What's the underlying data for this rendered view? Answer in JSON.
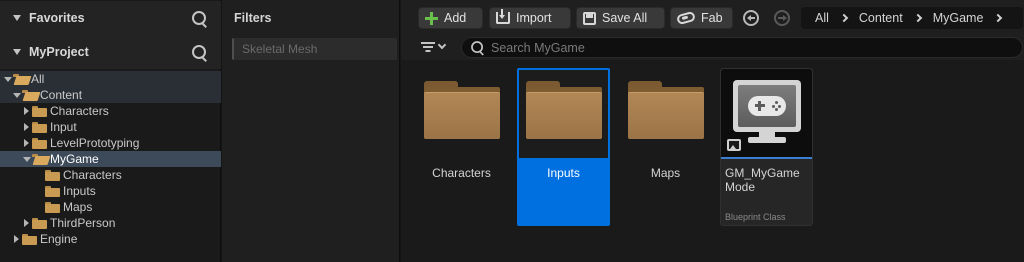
{
  "sidebar": {
    "favorites_label": "Favorites",
    "project_label": "MyProject",
    "tree": [
      {
        "label": "All"
      },
      {
        "label": "Content"
      },
      {
        "label": "Characters"
      },
      {
        "label": "Input"
      },
      {
        "label": "LevelPrototyping"
      },
      {
        "label": "MyGame"
      },
      {
        "label": "Characters"
      },
      {
        "label": "Inputs"
      },
      {
        "label": "Maps"
      },
      {
        "label": "ThirdPerson"
      },
      {
        "label": "Engine"
      }
    ]
  },
  "filters": {
    "title": "Filters",
    "items": [
      "Skeletal Mesh"
    ]
  },
  "toolbar": {
    "add_label": "Add",
    "import_label": "Import",
    "save_all_label": "Save All",
    "fab_label": "Fab"
  },
  "breadcrumb": [
    "All",
    "Content",
    "MyGame"
  ],
  "search": {
    "placeholder": "Search MyGame"
  },
  "assets": {
    "folders": [
      "Characters",
      "Inputs",
      "Maps"
    ],
    "selected_folder": "Inputs",
    "asset_name": "GM_MyGame Mode",
    "asset_type": "Blueprint Class"
  },
  "colors": {
    "selection": "#0070e0",
    "folder": "#a97e4e",
    "add_plus": "#6ac04b"
  }
}
